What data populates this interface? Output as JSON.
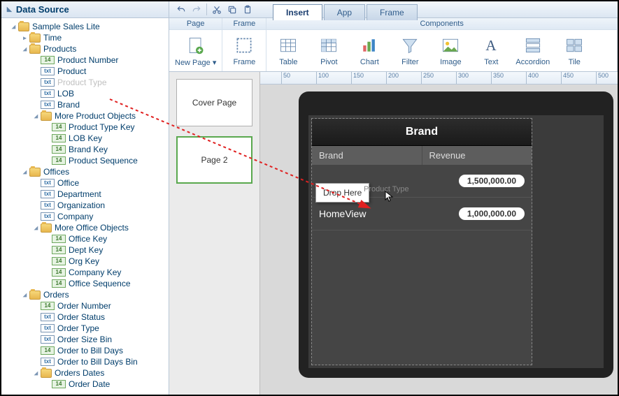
{
  "sidebar": {
    "title": "Data Source"
  },
  "tree": [
    {
      "indent": 0,
      "toggle": "expanded",
      "icon": "folder",
      "label": "Sample Sales Lite"
    },
    {
      "indent": 1,
      "toggle": "collapsed",
      "icon": "folder",
      "label": "Time"
    },
    {
      "indent": 1,
      "toggle": "expanded",
      "icon": "folder",
      "label": "Products"
    },
    {
      "indent": 2,
      "toggle": "none",
      "icon": "num",
      "label": "Product Number"
    },
    {
      "indent": 2,
      "toggle": "none",
      "icon": "txt",
      "label": "Product"
    },
    {
      "indent": 2,
      "toggle": "none",
      "icon": "txt",
      "label": "Product Type",
      "faded": true
    },
    {
      "indent": 2,
      "toggle": "none",
      "icon": "txt",
      "label": "LOB"
    },
    {
      "indent": 2,
      "toggle": "none",
      "icon": "txt",
      "label": "Brand"
    },
    {
      "indent": 2,
      "toggle": "expanded",
      "icon": "folder",
      "label": "More Product Objects"
    },
    {
      "indent": 3,
      "toggle": "none",
      "icon": "num",
      "label": "Product Type Key"
    },
    {
      "indent": 3,
      "toggle": "none",
      "icon": "num",
      "label": "LOB Key"
    },
    {
      "indent": 3,
      "toggle": "none",
      "icon": "num",
      "label": "Brand Key"
    },
    {
      "indent": 3,
      "toggle": "none",
      "icon": "num",
      "label": "Product Sequence"
    },
    {
      "indent": 1,
      "toggle": "expanded",
      "icon": "folder",
      "label": "Offices"
    },
    {
      "indent": 2,
      "toggle": "none",
      "icon": "txt",
      "label": "Office"
    },
    {
      "indent": 2,
      "toggle": "none",
      "icon": "txt",
      "label": "Department"
    },
    {
      "indent": 2,
      "toggle": "none",
      "icon": "txt",
      "label": "Organization"
    },
    {
      "indent": 2,
      "toggle": "none",
      "icon": "txt",
      "label": "Company"
    },
    {
      "indent": 2,
      "toggle": "expanded",
      "icon": "folder",
      "label": "More Office Objects"
    },
    {
      "indent": 3,
      "toggle": "none",
      "icon": "num",
      "label": "Office Key"
    },
    {
      "indent": 3,
      "toggle": "none",
      "icon": "num",
      "label": "Dept Key"
    },
    {
      "indent": 3,
      "toggle": "none",
      "icon": "num",
      "label": "Org Key"
    },
    {
      "indent": 3,
      "toggle": "none",
      "icon": "num",
      "label": "Company Key"
    },
    {
      "indent": 3,
      "toggle": "none",
      "icon": "num",
      "label": "Office Sequence"
    },
    {
      "indent": 1,
      "toggle": "expanded",
      "icon": "folder",
      "label": "Orders"
    },
    {
      "indent": 2,
      "toggle": "none",
      "icon": "num",
      "label": "Order Number"
    },
    {
      "indent": 2,
      "toggle": "none",
      "icon": "txt",
      "label": "Order Status"
    },
    {
      "indent": 2,
      "toggle": "none",
      "icon": "txt",
      "label": "Order Type"
    },
    {
      "indent": 2,
      "toggle": "none",
      "icon": "txt",
      "label": "Order Size Bin"
    },
    {
      "indent": 2,
      "toggle": "none",
      "icon": "num",
      "label": "Order to Bill Days"
    },
    {
      "indent": 2,
      "toggle": "none",
      "icon": "txt",
      "label": "Order to Bill Days Bin"
    },
    {
      "indent": 2,
      "toggle": "expanded",
      "icon": "folder",
      "label": "Orders Dates"
    },
    {
      "indent": 3,
      "toggle": "none",
      "icon": "num",
      "label": "Order Date"
    }
  ],
  "tabs": {
    "insert": "Insert",
    "app": "App",
    "frame": "Frame"
  },
  "ribbon": {
    "page_group": "Page",
    "frame_group": "Frame",
    "components_group": "Components",
    "new_page": "New Page",
    "frame": "Frame",
    "table": "Table",
    "pivot": "Pivot",
    "chart": "Chart",
    "filter": "Filter",
    "image": "Image",
    "text": "Text",
    "accordion": "Accordion",
    "tile": "Tile",
    "dropdown_indicator": "▾"
  },
  "ruler_marks": [
    "50",
    "100",
    "150",
    "200",
    "250",
    "300",
    "350",
    "400",
    "450",
    "500"
  ],
  "pages": {
    "p1": "Cover Page",
    "p2": "Page 2"
  },
  "widget": {
    "title": "Brand",
    "col1": "Brand",
    "col2": "Revenue",
    "rows": [
      {
        "label": "",
        "value": "1,500,000.00"
      },
      {
        "label": "HomeView",
        "value": "1,000,000.00"
      }
    ]
  },
  "drop": {
    "label": "Drop Here",
    "ghost": "Product Type"
  }
}
